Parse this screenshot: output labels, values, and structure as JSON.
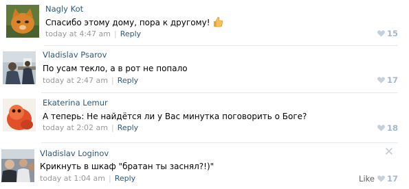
{
  "comments": [
    {
      "author": "Nagly Kot",
      "text": "Спасибо этому дому, пора к другому!",
      "emoji": "thumbs-up-emoji",
      "date": "today at 4:47 am",
      "reply_label": "Reply",
      "likes": "15",
      "avatar": "orange-cat-avatar"
    },
    {
      "author": "Vladislav Psarov",
      "text": "По усам текло, а в рот не попало",
      "date": "today at 2:47 am",
      "reply_label": "Reply",
      "likes": "17",
      "avatar": "man-at-desk-avatar"
    },
    {
      "author": "Ekaterina Lemur",
      "text": "А теперь: Не найдётся ли у Вас минутка поговорить о Боге?",
      "date": "today at 2:02 am",
      "reply_label": "Reply",
      "likes": "18",
      "avatar": "red-lemur-avatar"
    },
    {
      "author": "Vladislav Loginov",
      "text": "Крикнуть в шкаф \"братан ты заснял?!)\"",
      "date": "today at 1:04 am",
      "reply_label": "Reply",
      "like_label": "Like",
      "likes": "17",
      "avatar": "group-photo-avatar"
    }
  ],
  "colors": {
    "link": "#2b587a",
    "meta": "#999999",
    "heart": "#a6b7c8",
    "divider": "#e7e8ec"
  },
  "icons": {
    "heart": "heart-icon",
    "close": "close-icon"
  }
}
